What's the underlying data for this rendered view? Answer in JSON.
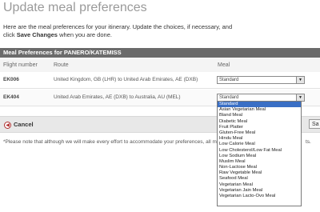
{
  "page": {
    "title": "Update meal preferences",
    "intro_text": "Here are the meal preferences for your itinerary. Update the choices, if necessary, and click",
    "intro_bold": "Save Changes",
    "intro_tail": "when you are done."
  },
  "panel": {
    "header": "Meal Preferences for PANERO/KATEMISS",
    "columns": {
      "flight": "Flight number",
      "route": "Route",
      "meal": "Meal"
    }
  },
  "flights": [
    {
      "number": "EK006",
      "route": "United Kingdom, GB (LHR) to United Arab Emirates, AE (DXB)",
      "meal": "Standard"
    },
    {
      "number": "EK404",
      "route": "United Arab Emirates, AE (DXB) to Australia, AU (MEL)",
      "meal": "Standard"
    }
  ],
  "actions": {
    "cancel": "Cancel",
    "save": "Sa"
  },
  "note": {
    "text": "*Please note that although we will make every effort to accommodate your preferences, all meal",
    "tail": "ts."
  },
  "meal_options": [
    "Standard",
    "Asian Vegetarian Meal",
    "Bland Meal",
    "Diabetic Meal",
    "Fruit Platter",
    "Gluten-Free Meal",
    "Hindu Meal",
    "Low Calorie Meal",
    "Low Cholesterol/Low Fat Meal",
    "Low Sodium Meal",
    "Muslim Meal",
    "Non-Lactose Meal",
    "Raw Vegetable Meal",
    "Seafood Meal",
    "Vegetarian Meal",
    "Vegetarian Jain Meal",
    "Vegetarian Lacto-Ovo Meal"
  ],
  "selected_option_index": 0,
  "colors": {
    "header_bg": "#6b6b6b",
    "selection": "#3a6fc5",
    "cancel_icon": "#b03030"
  }
}
